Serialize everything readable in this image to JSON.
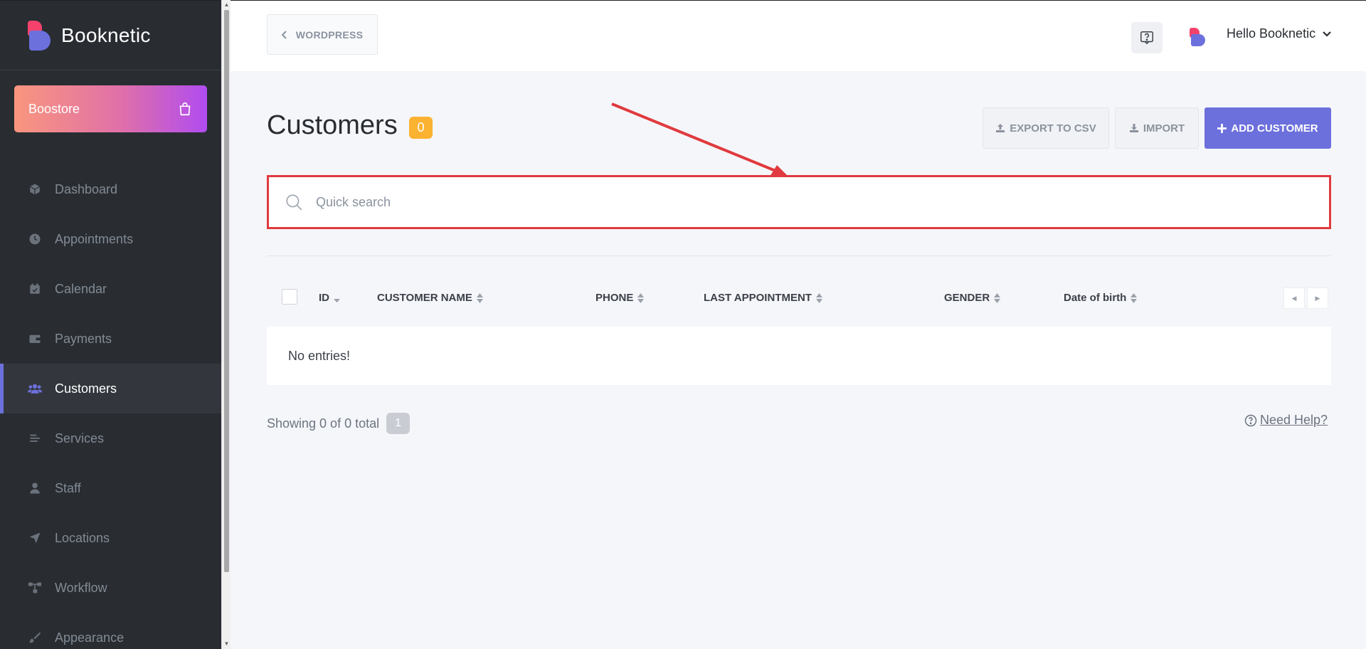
{
  "sidebar": {
    "brand": "Booknetic",
    "boostore": "Boostore",
    "items": [
      {
        "label": "Dashboard",
        "icon": "cube-icon"
      },
      {
        "label": "Appointments",
        "icon": "clock-icon"
      },
      {
        "label": "Calendar",
        "icon": "calendar-icon"
      },
      {
        "label": "Payments",
        "icon": "wallet-icon"
      },
      {
        "label": "Customers",
        "icon": "users-icon",
        "active": true
      },
      {
        "label": "Services",
        "icon": "list-icon"
      },
      {
        "label": "Staff",
        "icon": "user-icon"
      },
      {
        "label": "Locations",
        "icon": "location-arrow-icon"
      },
      {
        "label": "Workflow",
        "icon": "workflow-icon"
      },
      {
        "label": "Appearance",
        "icon": "brush-icon"
      }
    ]
  },
  "topbar": {
    "back_label": "WORDPRESS",
    "user_greeting": "Hello Booknetic"
  },
  "page": {
    "title": "Customers",
    "count": "0",
    "export_label": "EXPORT TO CSV",
    "import_label": "IMPORT",
    "add_label": "ADD CUSTOMER"
  },
  "search": {
    "placeholder": "Quick search",
    "value": ""
  },
  "table": {
    "columns": [
      "ID",
      "CUSTOMER NAME",
      "PHONE",
      "LAST APPOINTMENT",
      "GENDER",
      "Date of birth"
    ],
    "empty_text": "No entries!"
  },
  "footer": {
    "showing": "Showing 0 of 0 total",
    "page": "1",
    "need_help": "Need Help?"
  },
  "colors": {
    "accent": "#6c70dc",
    "sidebar_bg": "#292d32",
    "badge": "#fbb230",
    "highlight": "#e03a3e"
  }
}
